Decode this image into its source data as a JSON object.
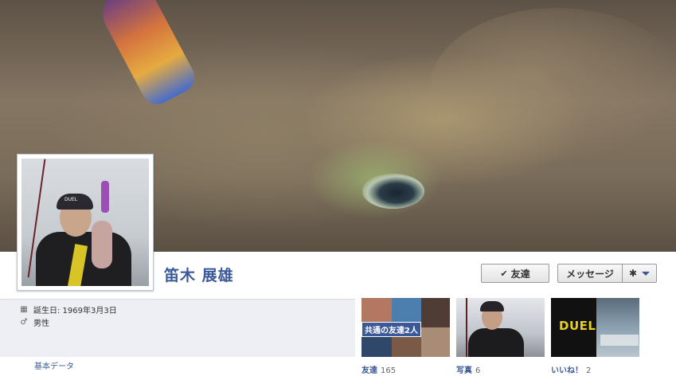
{
  "profile": {
    "name": "笛木 展雄",
    "cap_logo": "DUEL"
  },
  "actions": {
    "friend_label": "友達",
    "message_label": "メッセージ",
    "check_icon": "✔",
    "gear_icon": "✱"
  },
  "about": {
    "birthday": "誕生日: 1969年3月3日",
    "gender": "男性",
    "basic_link": "基本データ",
    "calendar_icon": "▦",
    "gender_icon": "♂"
  },
  "tiles": [
    {
      "label": "友達",
      "count": "165",
      "badge": "共通の友達2人"
    },
    {
      "label": "写真",
      "count": "6"
    },
    {
      "label": "いいね！",
      "count": "2",
      "logo": "DUEL"
    }
  ]
}
